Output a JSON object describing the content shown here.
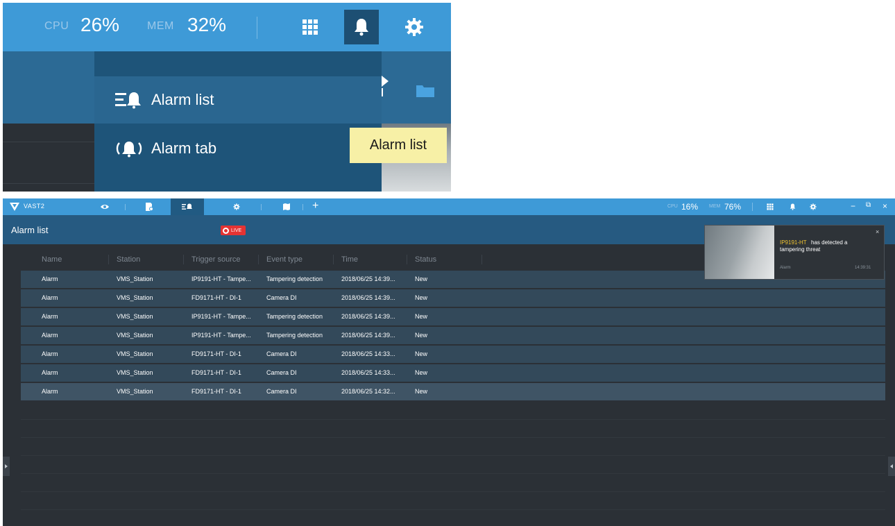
{
  "inset": {
    "cpu_label": "CPU",
    "cpu_value": "26%",
    "mem_label": "MEM",
    "mem_value": "32%",
    "toolbar_icons": [
      "grid-icon",
      "bell-icon",
      "gear-icon"
    ],
    "active_icon": "bell-icon",
    "menu": [
      {
        "label": "Alarm list",
        "icon": "alarm-list-icon",
        "highlighted": true
      },
      {
        "label": "Alarm tab",
        "icon": "alarm-tab-icon",
        "highlighted": false
      }
    ],
    "tooltip": "Alarm list"
  },
  "app": {
    "name": "VAST2",
    "tabs": [
      "eye-icon",
      "file-settings-icon",
      "alarm-list-icon",
      "gear-icon",
      "map-icon"
    ],
    "active_tab": "alarm-list-icon",
    "add_tab": "+",
    "cpu_label": "CPU",
    "cpu_value": "16%",
    "mem_label": "MEM",
    "mem_value": "76%",
    "window_controls": {
      "minimize": "−",
      "restore": "⧉",
      "close": "×"
    },
    "page_title": "Alarm list",
    "live_label": "LIVE",
    "accent": "#3e9ad7",
    "live_color": "#e53333"
  },
  "table": {
    "columns": [
      "Name",
      "Station",
      "Trigger source",
      "Event type",
      "Time",
      "Status"
    ],
    "rows": [
      [
        "Alarm",
        "VMS_Station",
        "IP9191-HT - Tampe...",
        "Tampering detection",
        "2018/06/25 14:39...",
        "New"
      ],
      [
        "Alarm",
        "VMS_Station",
        "FD9171-HT - DI-1",
        "Camera DI",
        "2018/06/25 14:39...",
        "New"
      ],
      [
        "Alarm",
        "VMS_Station",
        "IP9191-HT - Tampe...",
        "Tampering detection",
        "2018/06/25 14:39...",
        "New"
      ],
      [
        "Alarm",
        "VMS_Station",
        "IP9191-HT - Tampe...",
        "Tampering detection",
        "2018/06/25 14:39...",
        "New"
      ],
      [
        "Alarm",
        "VMS_Station",
        "FD9171-HT - DI-1",
        "Camera DI",
        "2018/06/25 14:33...",
        "New"
      ],
      [
        "Alarm",
        "VMS_Station",
        "FD9171-HT - DI-1",
        "Camera DI",
        "2018/06/25 14:33...",
        "New"
      ],
      [
        "Alarm",
        "VMS_Station",
        "FD9171-HT - DI-1",
        "Camera DI",
        "2018/06/25 14:32...",
        "New"
      ]
    ]
  },
  "notification": {
    "source": "IP9191-HT",
    "message_part1": "has detected a",
    "message_part2": "tampering threat",
    "type": "Alarm",
    "time": "14:39:31",
    "close": "×",
    "source_color": "#f0c330"
  }
}
